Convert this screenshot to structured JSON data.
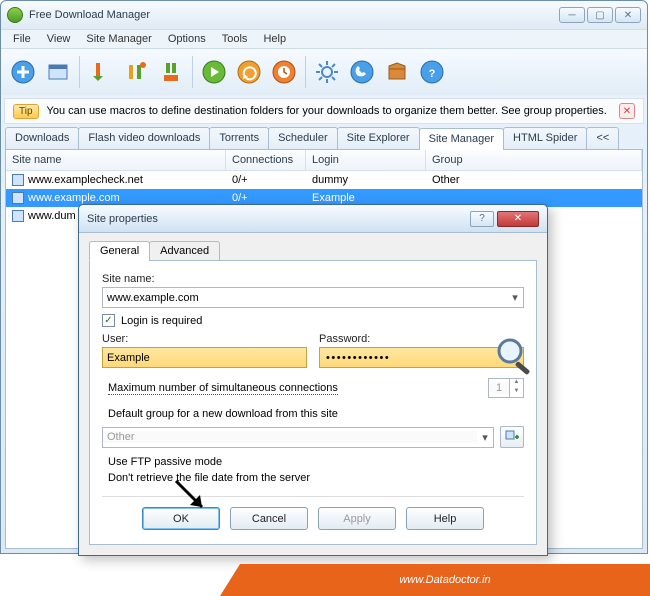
{
  "app": {
    "title": "Free Download Manager"
  },
  "menu": {
    "file": "File",
    "view": "View",
    "siteManager": "Site Manager",
    "options": "Options",
    "tools": "Tools",
    "help": "Help"
  },
  "tip": {
    "badge": "Tip",
    "text": "You can use macros to define destination folders for your downloads to organize them better. See group properties."
  },
  "tabs": {
    "downloads": "Downloads",
    "flash": "Flash video downloads",
    "torrents": "Torrents",
    "scheduler": "Scheduler",
    "siteExplorer": "Site Explorer",
    "siteManager": "Site Manager",
    "htmlSpider": "HTML Spider",
    "more": "<<"
  },
  "columns": {
    "site": "Site name",
    "conn": "Connections",
    "login": "Login",
    "group": "Group"
  },
  "rows": [
    {
      "site": "www.examplecheck.net",
      "conn": "0/+",
      "login": "dummy",
      "group": "Other"
    },
    {
      "site": "www.example.com",
      "conn": "0/+",
      "login": "Example",
      "group": ""
    },
    {
      "site": "www.dum",
      "conn": "",
      "login": "",
      "group": ""
    }
  ],
  "dialog": {
    "title": "Site properties",
    "tabs": {
      "general": "General",
      "advanced": "Advanced"
    },
    "labels": {
      "siteName": "Site name:",
      "loginReq": "Login is required",
      "user": "User:",
      "password": "Password:",
      "maxConn": "Maximum number of simultaneous connections",
      "defGroup": "Default group for a new download from this site",
      "ftpPassive": "Use FTP passive mode",
      "noDate": "Don't retrieve the file date from the server"
    },
    "values": {
      "siteName": "www.example.com",
      "user": "Example",
      "password": "••••••••••••",
      "spin": "1",
      "group": "Other"
    },
    "buttons": {
      "ok": "OK",
      "cancel": "Cancel",
      "apply": "Apply",
      "help": "Help"
    }
  },
  "footer": {
    "url": "www.Datadoctor.in"
  }
}
